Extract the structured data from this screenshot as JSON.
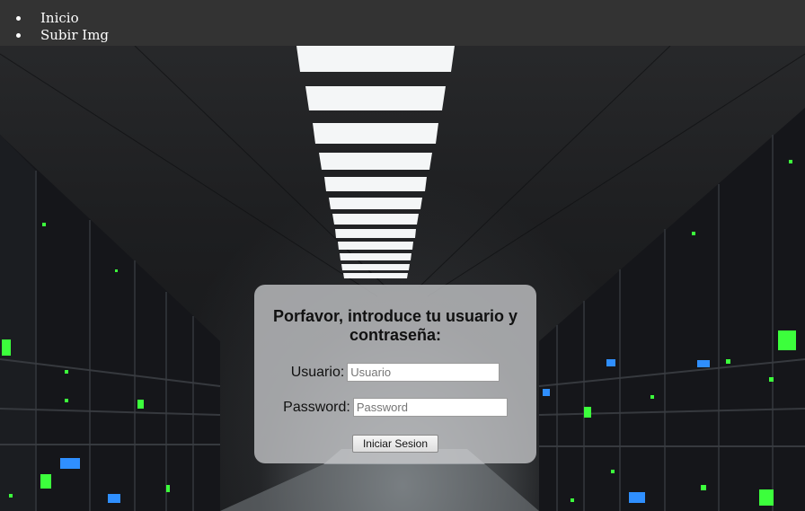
{
  "nav": {
    "items": [
      {
        "label": "Inicio"
      },
      {
        "label": "Subir Img"
      }
    ]
  },
  "login": {
    "title": "Porfavor, introduce tu usuario y contraseña:",
    "username_label": "Usuario:",
    "username_placeholder": "Usuario",
    "username_value": "",
    "password_label": "Password:",
    "password_placeholder": "Password",
    "password_value": "",
    "submit_label": "Iniciar Sesion"
  },
  "background": {
    "description_icon": "server-room-background",
    "led_color": "#3cff3c",
    "panel_color": "#bfc1c3"
  }
}
